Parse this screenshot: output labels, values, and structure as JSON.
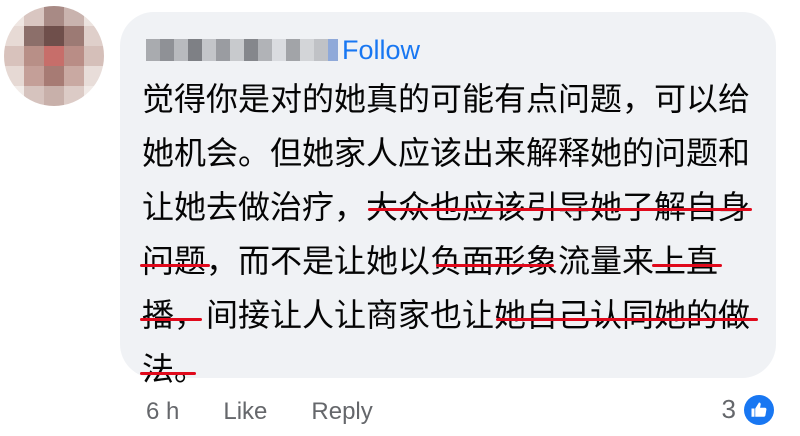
{
  "comment": {
    "follow_label": "Follow",
    "lines": [
      "觉得你是对的她真的可能有点问题，可以给",
      "她机会。但她家人应该出来解释她的问题和",
      "让她去做治疗，大众也应该引导她了解自身",
      "问题，而不是让她以负面形象流量来上直",
      "播，间接让人让商家也让她自己认同她的做",
      "法。"
    ]
  },
  "actions": {
    "time": "6 h",
    "like": "Like",
    "reply": "Reply"
  },
  "reactions": {
    "count": "3",
    "icon": "thumbs-up-icon"
  },
  "colors": {
    "bubble": "#f0f2f5",
    "link": "#1877f2",
    "underline": "#e0091b",
    "meta": "#65676b"
  }
}
